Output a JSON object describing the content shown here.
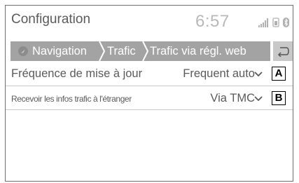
{
  "header": {
    "title": "Configuration",
    "clock": "6:57",
    "status_icons": [
      "signal-bars-icon",
      "phone-battery-icon",
      "bluetooth-icon"
    ]
  },
  "breadcrumb": {
    "items": [
      "Navigation",
      "Trafic",
      "Trafic via régl. web"
    ],
    "icons": [
      "compass-icon"
    ],
    "back_icon": "back-arrow-icon"
  },
  "settings": [
    {
      "label": "Fréquence de mise à jour",
      "value": "Frequent auto",
      "callout": "A"
    },
    {
      "label": "Recevoir les infos trafic à l'étranger",
      "value": "Via TMC",
      "callout": "B"
    }
  ],
  "colors": {
    "breadcrumb_bg": "#a3a3a3",
    "back_button_bg": "#c8c8c8",
    "text": "#5a5a5a",
    "clock": "#b9b9b9",
    "divider": "#c9c9c9"
  }
}
